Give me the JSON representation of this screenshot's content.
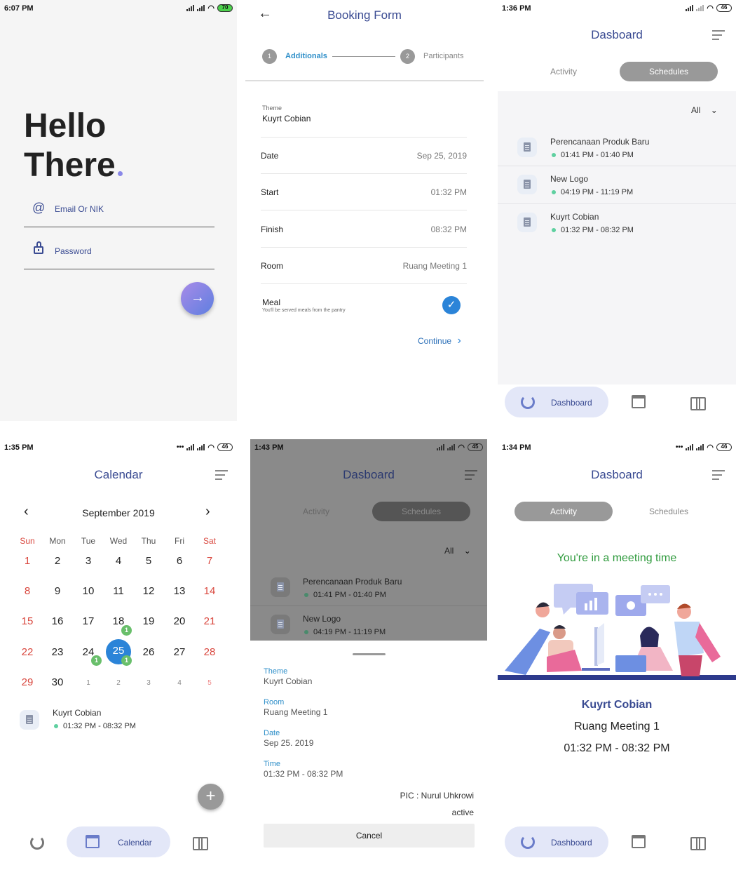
{
  "login": {
    "status_time": "6:07 PM",
    "battery": "70",
    "greeting_line1": "Hello",
    "greeting_line2": "There",
    "email_placeholder": "Email Or NIK",
    "password_placeholder": "Password"
  },
  "booking": {
    "title": "Booking Form",
    "step1_num": "1",
    "step1_label": "Additionals",
    "step2_num": "2",
    "step2_label": "Participants",
    "theme_label": "Theme",
    "theme_value": "Kuyrt Cobian",
    "rows": [
      {
        "label": "Date",
        "value": "Sep 25, 2019"
      },
      {
        "label": "Start",
        "value": "01:32 PM"
      },
      {
        "label": "Finish",
        "value": "08:32 PM"
      },
      {
        "label": "Room",
        "value": "Ruang Meeting 1"
      }
    ],
    "meal_label": "Meal",
    "meal_desc": "You'll be served meals from the pantry",
    "continue_label": "Continue"
  },
  "dashboard_schedules": {
    "status_time": "1:36 PM",
    "battery": "46",
    "title": "Dasboard",
    "tab_activity": "Activity",
    "tab_schedules": "Schedules",
    "filter": "All",
    "items": [
      {
        "title": "Perencanaan Produk Baru",
        "time": "01:41 PM - 01:40 PM"
      },
      {
        "title": "New Logo",
        "time": "04:19 PM - 11:19 PM"
      },
      {
        "title": "Kuyrt Cobian",
        "time": "01:32 PM - 08:32 PM"
      }
    ],
    "nav_dashboard": "Dashboard"
  },
  "calendar": {
    "status_time": "1:35 PM",
    "battery": "46",
    "title": "Calendar",
    "month": "September 2019",
    "weekdays": [
      "Sun",
      "Mon",
      "Tue",
      "Wed",
      "Thu",
      "Fri",
      "Sat"
    ],
    "weeks": [
      [
        "1",
        "2",
        "3",
        "4",
        "5",
        "6",
        "7"
      ],
      [
        "8",
        "9",
        "10",
        "11",
        "12",
        "13",
        "14"
      ],
      [
        "15",
        "16",
        "17",
        "18",
        "19",
        "20",
        "21"
      ],
      [
        "22",
        "23",
        "24",
        "25",
        "26",
        "27",
        "28"
      ],
      [
        "29",
        "30",
        "1",
        "2",
        "3",
        "4",
        "5"
      ]
    ],
    "badge_18": "1",
    "badge_24": "1",
    "badge_25": "1",
    "event_title": "Kuyrt Cobian",
    "event_time": "01:32 PM - 08:32 PM",
    "nav_calendar": "Calendar"
  },
  "dashboard_sheet": {
    "status_time": "1:43 PM",
    "battery": "45",
    "title": "Dasboard",
    "tab_activity": "Activity",
    "tab_schedules": "Schedules",
    "filter": "All",
    "items": [
      {
        "title": "Perencanaan Produk Baru",
        "time": "01:41 PM - 01:40 PM"
      },
      {
        "title": "New Logo",
        "time": "04:19 PM - 11:19 PM"
      }
    ],
    "theme_label": "Theme",
    "theme_value": "Kuyrt Cobian",
    "room_label": "Room",
    "room_value": "Ruang Meeting 1",
    "date_label": "Date",
    "date_value": "Sep 25. 2019",
    "time_label": "Time",
    "time_value": "01:32 PM - 08:32 PM",
    "pic": "PIC : Nurul Uhkrowi",
    "state": "active",
    "cancel_label": "Cancel"
  },
  "dashboard_activity": {
    "status_time": "1:34 PM",
    "battery": "46",
    "title": "Dasboard",
    "tab_activity": "Activity",
    "tab_schedules": "Schedules",
    "headline": "You're in a meeting time",
    "meeting_title": "Kuyrt Cobian",
    "meeting_room": "Ruang Meeting 1",
    "meeting_time": "01:32 PM - 08:32 PM",
    "nav_dashboard": "Dashboard"
  },
  "colors": {
    "accent_blue": "#3a4b92",
    "link_blue": "#2f8fc9",
    "green_headline": "#2e9a3c",
    "weekend_red": "#d9473e"
  }
}
